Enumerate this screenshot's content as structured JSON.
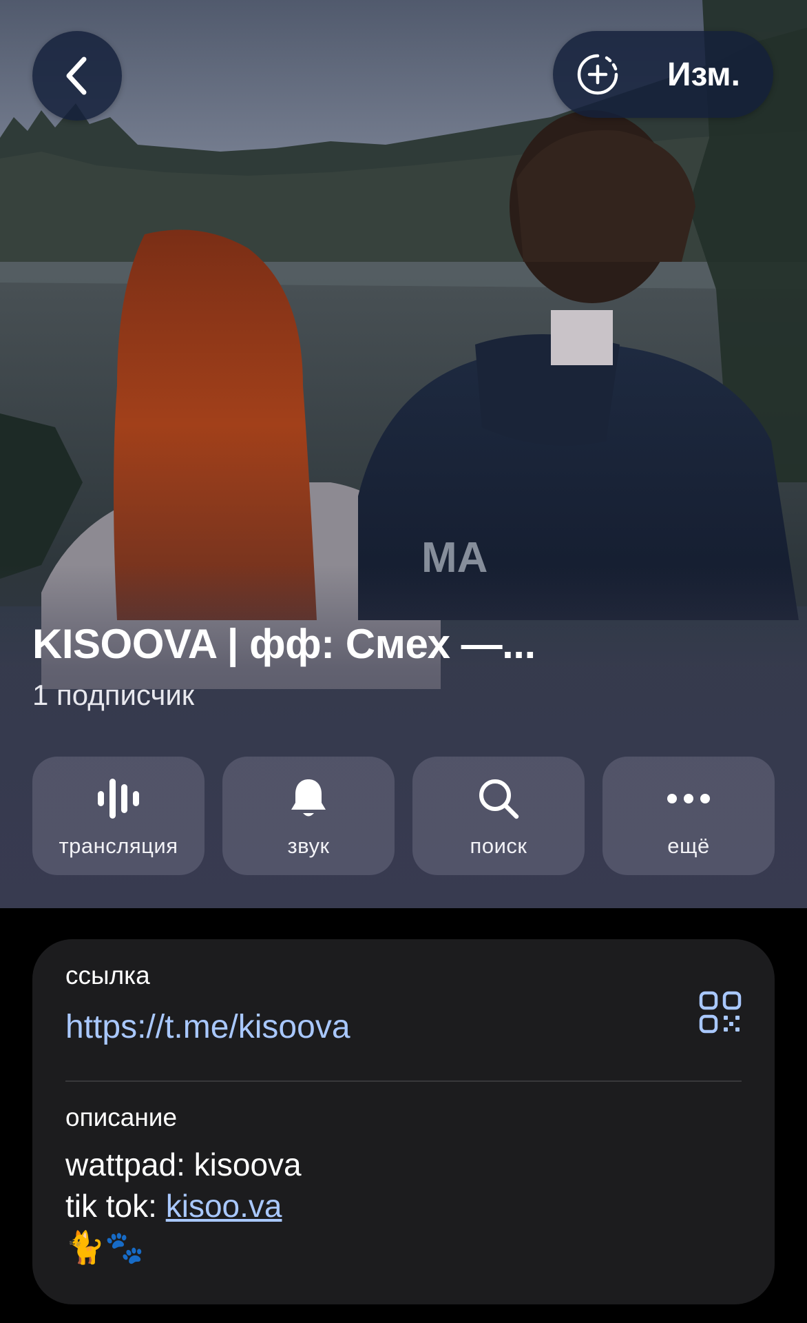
{
  "header": {
    "back_icon": "chevron-left-icon",
    "edit_icon": "add-circle-dashed-icon",
    "edit_label": "Изм."
  },
  "channel": {
    "title": "KISOOVA | фф: Смех —...",
    "subscribers": "1 подписчик"
  },
  "actions": [
    {
      "label": "трансляция",
      "icon": "live-stream-icon"
    },
    {
      "label": "звук",
      "icon": "bell-icon"
    },
    {
      "label": "поиск",
      "icon": "search-icon"
    },
    {
      "label": "ещё",
      "icon": "more-icon"
    }
  ],
  "info": {
    "link_caption": "ссылка",
    "link_value": "https://t.me/kisoova",
    "qr_icon": "qr-code-icon",
    "description_caption": "описание",
    "description_line1": "wattpad: kisoova",
    "description_line2_prefix": "tik tok: ",
    "description_line2_link": "kisoo.va",
    "description_emoji": "🐈🐾"
  },
  "colors": {
    "link": "#a9c8ff",
    "card_bg": "#1c1c1e",
    "page_bg": "#000000",
    "button_bg": "#14203a"
  }
}
